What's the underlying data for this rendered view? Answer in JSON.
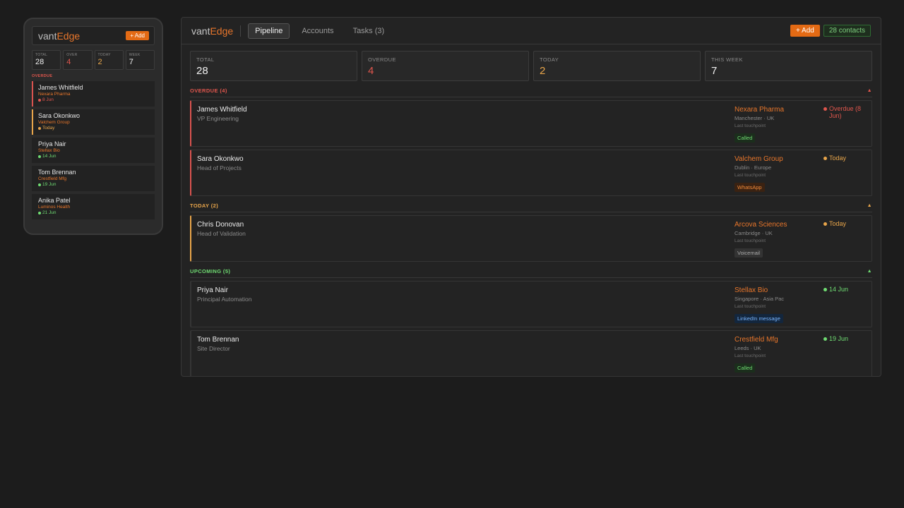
{
  "brand": {
    "part1": "vant",
    "part2": "Edge"
  },
  "colors": {
    "accent": "#e36a14",
    "overdue": "#d9534f",
    "today": "#e8a54a",
    "upcoming": "#6fdc72"
  },
  "phone": {
    "add_label": "+ Add",
    "stats": [
      {
        "label": "TOTAL",
        "value": "28"
      },
      {
        "label": "OVER",
        "value": "4"
      },
      {
        "label": "TODAY",
        "value": "2"
      },
      {
        "label": "WEEK",
        "value": "7"
      }
    ],
    "section_label": "OVERDUE",
    "cards": [
      {
        "name": "James Whitfield",
        "company": "Nexara Pharma",
        "date": "8 Jun"
      },
      {
        "name": "Sara Okonkwo",
        "company": "Valchem Group",
        "date": "Today"
      },
      {
        "name": "Priya Nair",
        "company": "Stellax Bio",
        "date": "14 Jun"
      },
      {
        "name": "Tom Brennan",
        "company": "Crestfield Mfg",
        "date": "19 Jun"
      },
      {
        "name": "Anika Patel",
        "company": "Luminos Health",
        "date": "21 Jun"
      }
    ]
  },
  "main": {
    "tabs": [
      {
        "label": "Pipeline"
      },
      {
        "label": "Accounts"
      },
      {
        "label": "Tasks (3)"
      }
    ],
    "add_label": "+ Add",
    "contacts_badge": "28 contacts",
    "stats": [
      {
        "label": "TOTAL",
        "value": "28"
      },
      {
        "label": "OVERDUE",
        "value": "4"
      },
      {
        "label": "TODAY",
        "value": "2"
      },
      {
        "label": "THIS WEEK",
        "value": "7"
      }
    ],
    "sections": {
      "overdue": {
        "title": "OVERDUE (4)",
        "rows": [
          {
            "name": "James Whitfield",
            "role": "VP Engineering",
            "company": "Nexara Pharma",
            "location": "Manchester · UK",
            "touch": "Last touchpoint",
            "tag": "Called",
            "status": "Overdue (8 Jun)"
          },
          {
            "name": "Sara Okonkwo",
            "role": "Head of Projects",
            "company": "Valchem Group",
            "location": "Dublin · Europe",
            "touch": "Last touchpoint",
            "tag": "WhatsApp",
            "status": "Today"
          }
        ]
      },
      "today": {
        "title": "TODAY (2)",
        "rows": [
          {
            "name": "Chris Donovan",
            "role": "Head of Validation",
            "company": "Arcova Sciences",
            "location": "Cambridge · UK",
            "touch": "Last touchpoint",
            "tag": "Voicemail",
            "status": "Today"
          }
        ]
      },
      "upcoming": {
        "title": "UPCOMING (5)",
        "rows": [
          {
            "name": "Priya Nair",
            "role": "Principal Automation",
            "company": "Stellax Bio",
            "location": "Singapore · Asia Pac",
            "touch": "Last touchpoint",
            "tag": "LinkedIn message",
            "status": "14 Jun"
          },
          {
            "name": "Tom Brennan",
            "role": "Site Director",
            "company": "Crestfield Mfg",
            "location": "Leeds · UK",
            "touch": "Last touchpoint",
            "tag": "Called",
            "status": "19 Jun"
          }
        ]
      }
    }
  }
}
